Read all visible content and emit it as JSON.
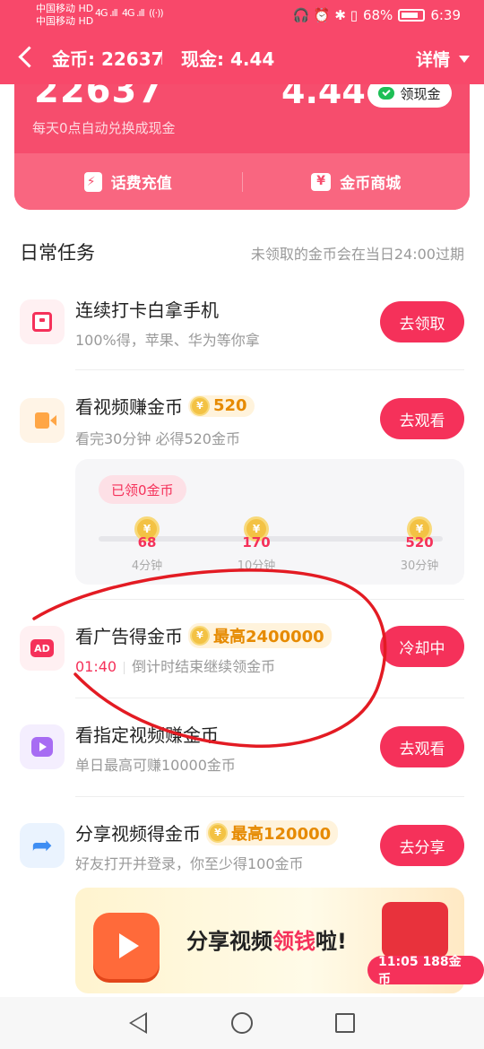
{
  "status_bar": {
    "carrier_1": "中国移动 HD",
    "carrier_2": "中国移动 HD",
    "signal_1": "4G .ıll",
    "signal_2": "4G .ıll",
    "wifi": "((·))",
    "icons": "🎧 ⏰ ✱ ▯",
    "battery": "68%",
    "time": "6:39"
  },
  "header": {
    "coins_label": "金币: 22637",
    "cash_label": "现金: 4.44",
    "detail_label": "详情"
  },
  "top_card": {
    "coins_value": "22637",
    "cash_value": "4.44",
    "withdraw_label": "领现金",
    "auto_exchange_note": "每天0点自动兑换成现金",
    "actions": [
      "话费充值",
      "金币商城"
    ]
  },
  "daily_tasks": {
    "title": "日常任务",
    "note": "未领取的金币会在当日24:00过期",
    "tasks": [
      {
        "title": "连续打卡白拿手机",
        "subtitle": "100%得，苹果、华为等你拿",
        "button": "去领取"
      },
      {
        "title": "看视频赚金币",
        "reward": "520",
        "subtitle": "看完30分钟 必得520金币",
        "button": "去观看",
        "progress": {
          "claimed_label": "已领0金币",
          "milestones": [
            {
              "value": "68",
              "label": "4分钟"
            },
            {
              "value": "170",
              "label": "10分钟"
            },
            {
              "value": "520",
              "label": "30分钟"
            }
          ]
        }
      },
      {
        "title": "看广告得金币",
        "reward": "最高2400000",
        "countdown": "01:40",
        "subtitle": "倒计时结束继续领金币",
        "button": "冷却中"
      },
      {
        "title": "看指定视频赚金币",
        "subtitle": "单日最高可赚10000金币",
        "button": "去观看"
      },
      {
        "title": "分享视频得金币",
        "reward": "最高120000",
        "subtitle": "好友打开并登录，你至少得100金币",
        "button": "去分享"
      }
    ]
  },
  "banner": {
    "text_prefix": "分享视频",
    "text_accent": "领钱",
    "text_suffix": "啦!",
    "timer_label": "11:05 188金币"
  },
  "coin_symbol": "¥",
  "colors": {
    "primary": "#f8486a",
    "button": "#f5315a",
    "coin": "#f3c244"
  }
}
